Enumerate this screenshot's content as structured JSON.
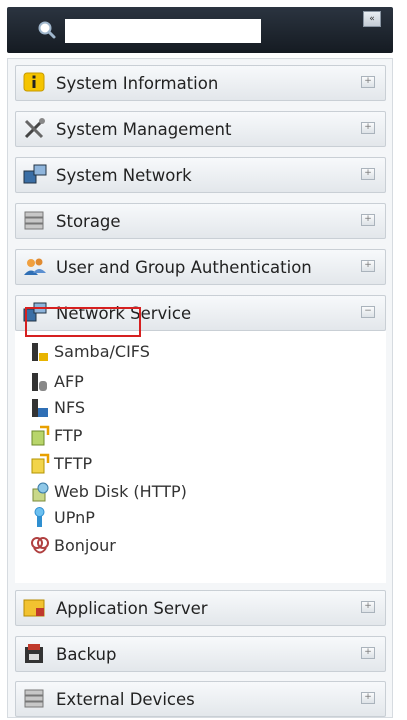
{
  "search": {
    "placeholder": "",
    "value": ""
  },
  "collapse_label": "«",
  "sections_top": [
    {
      "label": "System Information",
      "icon": "info-icon",
      "toggle": "+"
    },
    {
      "label": "System Management",
      "icon": "tools-icon",
      "toggle": "+"
    },
    {
      "label": "System Network",
      "icon": "network-icon",
      "toggle": "+"
    },
    {
      "label": "Storage",
      "icon": "storage-icon",
      "toggle": "+"
    },
    {
      "label": "User and Group Authentication",
      "icon": "users-icon",
      "toggle": "+"
    },
    {
      "label": "Network Service",
      "icon": "network-service-icon",
      "toggle": "−",
      "expanded": true
    }
  ],
  "network_service_items": [
    {
      "label": "Samba/CIFS",
      "icon": "samba-icon"
    },
    {
      "label": "AFP",
      "icon": "afp-icon",
      "highlighted": true
    },
    {
      "label": "NFS",
      "icon": "nfs-icon"
    },
    {
      "label": "FTP",
      "icon": "ftp-icon"
    },
    {
      "label": "TFTP",
      "icon": "tftp-icon"
    },
    {
      "label": "Web Disk (HTTP)",
      "icon": "web-disk-icon"
    },
    {
      "label": "UPnP",
      "icon": "upnp-icon"
    },
    {
      "label": "Bonjour",
      "icon": "bonjour-icon"
    }
  ],
  "sections_bottom": [
    {
      "label": "Application Server",
      "icon": "app-server-icon",
      "toggle": "+"
    },
    {
      "label": "Backup",
      "icon": "backup-icon",
      "toggle": "+"
    },
    {
      "label": "External Devices",
      "icon": "external-devices-icon",
      "toggle": "+"
    }
  ],
  "colors": {
    "highlight": "#d62020",
    "topbar": "#1c232b"
  }
}
